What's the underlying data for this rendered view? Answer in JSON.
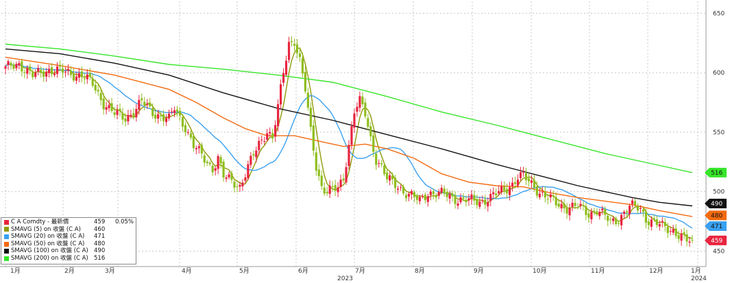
{
  "chart_data": {
    "type": "candlestick",
    "y_axis": {
      "ticks": [
        450,
        500,
        550,
        600,
        650
      ],
      "tick_labels": [
        "450",
        "500",
        "550",
        "600",
        "650"
      ],
      "range": [
        437,
        660
      ],
      "position": "right"
    },
    "x_axis": {
      "month_labels": [
        "1月",
        "2月",
        "3月",
        "4月",
        "5月",
        "6月",
        "7月",
        "8月",
        "9月",
        "10月",
        "11月",
        "12月",
        "1月"
      ],
      "year_labels": [
        "2023",
        "2024"
      ]
    },
    "colors": {
      "up": "#e8253f",
      "down": "#8fbe1e"
    },
    "candles": {
      "anchors": [
        [
          0,
          603
        ],
        [
          5,
          608
        ],
        [
          10,
          597
        ],
        [
          16,
          603
        ],
        [
          22,
          600
        ],
        [
          28,
          598
        ],
        [
          32,
          590
        ],
        [
          36,
          575
        ],
        [
          40,
          565
        ],
        [
          44,
          562
        ],
        [
          48,
          570
        ],
        [
          50,
          575
        ],
        [
          54,
          567
        ],
        [
          56,
          565
        ],
        [
          60,
          560
        ],
        [
          62,
          570
        ],
        [
          66,
          555
        ],
        [
          69,
          538
        ],
        [
          72,
          530
        ],
        [
          76,
          520
        ],
        [
          78,
          528
        ],
        [
          80,
          512
        ],
        [
          84,
          508
        ],
        [
          86,
          505
        ],
        [
          90,
          525
        ],
        [
          93,
          540
        ],
        [
          96,
          552
        ],
        [
          98,
          545
        ],
        [
          100,
          570
        ],
        [
          102,
          600
        ],
        [
          104,
          625
        ],
        [
          106,
          628
        ],
        [
          108,
          610
        ],
        [
          110,
          585
        ],
        [
          112,
          550
        ],
        [
          114,
          522
        ],
        [
          116,
          505
        ],
        [
          118,
          500
        ],
        [
          122,
          502
        ],
        [
          124,
          512
        ],
        [
          126,
          540
        ],
        [
          128,
          568
        ],
        [
          130,
          575
        ],
        [
          132,
          565
        ],
        [
          134,
          545
        ],
        [
          136,
          528
        ],
        [
          138,
          520
        ],
        [
          140,
          510
        ],
        [
          144,
          505
        ],
        [
          148,
          497
        ],
        [
          152,
          492
        ],
        [
          155,
          500
        ],
        [
          158,
          498
        ],
        [
          162,
          497
        ],
        [
          166,
          494
        ],
        [
          170,
          492
        ],
        [
          174,
          492
        ],
        [
          178,
          495
        ],
        [
          182,
          500
        ],
        [
          186,
          507
        ],
        [
          188,
          512
        ],
        [
          190,
          512
        ],
        [
          194,
          505
        ],
        [
          196,
          500
        ],
        [
          198,
          496
        ],
        [
          202,
          490
        ],
        [
          206,
          487
        ],
        [
          210,
          487
        ],
        [
          214,
          482
        ],
        [
          217,
          485
        ],
        [
          222,
          474
        ],
        [
          225,
          478
        ],
        [
          229,
          487
        ],
        [
          233,
          486
        ],
        [
          235,
          478
        ],
        [
          238,
          474
        ],
        [
          241,
          470
        ],
        [
          245,
          468
        ],
        [
          248,
          462
        ],
        [
          250,
          458
        ],
        [
          252,
          457
        ]
      ],
      "count": 253
    },
    "series": [
      {
        "name": "SMAVG (5)",
        "color": "#8f9a08",
        "kind": "sma",
        "period": 5
      },
      {
        "name": "SMAVG (20)",
        "color": "#3aa0f0",
        "kind": "sma",
        "period": 20
      },
      {
        "name": "SMAVG (50)",
        "color": "#f26a10",
        "points": [
          [
            0,
            613
          ],
          [
            20,
            606
          ],
          [
            40,
            598
          ],
          [
            60,
            586
          ],
          [
            70,
            575
          ],
          [
            80,
            562
          ],
          [
            88,
            553
          ],
          [
            96,
            547
          ],
          [
            106,
            547
          ],
          [
            116,
            542
          ],
          [
            124,
            538
          ],
          [
            132,
            540
          ],
          [
            140,
            536
          ],
          [
            150,
            528
          ],
          [
            160,
            515
          ],
          [
            170,
            508
          ],
          [
            180,
            505
          ],
          [
            190,
            504
          ],
          [
            200,
            499
          ],
          [
            210,
            495
          ],
          [
            220,
            492
          ],
          [
            230,
            489
          ],
          [
            240,
            484
          ],
          [
            252,
            479
          ]
        ]
      },
      {
        "name": "SMAVG (100)",
        "color": "#111111",
        "points": [
          [
            0,
            620
          ],
          [
            20,
            616
          ],
          [
            40,
            608
          ],
          [
            60,
            598
          ],
          [
            80,
            583
          ],
          [
            100,
            570
          ],
          [
            120,
            560
          ],
          [
            140,
            548
          ],
          [
            160,
            536
          ],
          [
            180,
            523
          ],
          [
            200,
            511
          ],
          [
            210,
            505
          ],
          [
            220,
            500
          ],
          [
            230,
            495
          ],
          [
            240,
            491
          ],
          [
            252,
            488
          ]
        ]
      },
      {
        "name": "SMAVG (200)",
        "color": "#37e52a",
        "points": [
          [
            0,
            624
          ],
          [
            20,
            620
          ],
          [
            40,
            614
          ],
          [
            60,
            607
          ],
          [
            80,
            603
          ],
          [
            100,
            598
          ],
          [
            120,
            592
          ],
          [
            140,
            580
          ],
          [
            160,
            567
          ],
          [
            180,
            556
          ],
          [
            200,
            544
          ],
          [
            220,
            532
          ],
          [
            240,
            522
          ],
          [
            252,
            516
          ]
        ]
      }
    ],
    "price_tags": [
      {
        "value": 516,
        "label": "516",
        "bg": "#37e52a",
        "fg": "#111111"
      },
      {
        "value": 490,
        "label": "490",
        "bg": "#111111",
        "fg": "#ffffff"
      },
      {
        "value": 480,
        "label": "480",
        "bg": "#f26a10",
        "fg": "#111111"
      },
      {
        "value": 471,
        "label": "471",
        "bg": "#3aa0f0",
        "fg": "#111111"
      },
      {
        "value": 459,
        "label": "459",
        "bg": "#e8253f",
        "fg": "#ffffff"
      }
    ]
  },
  "legend": {
    "rows": [
      {
        "label": "C A Comdty - 最新價",
        "value": "459",
        "change": "0.05%",
        "color": "#e8253f"
      },
      {
        "label": "SMAVG (5)  on 收盤 (C A)",
        "value": "460",
        "change": "",
        "color": "#8f9a08"
      },
      {
        "label": "SMAVG (20)  on 收盤 (C A)",
        "value": "471",
        "change": "",
        "color": "#3aa0f0"
      },
      {
        "label": "SMAVG (50)  on 收盤 (C A)",
        "value": "480",
        "change": "",
        "color": "#f26a10"
      },
      {
        "label": "SMAVG (100)  on 收盤 (C A)",
        "value": "490",
        "change": "",
        "color": "#111111"
      },
      {
        "label": "SMAVG (200)  on 收盤 (C A)",
        "value": "516",
        "change": "",
        "color": "#37e52a"
      }
    ]
  }
}
